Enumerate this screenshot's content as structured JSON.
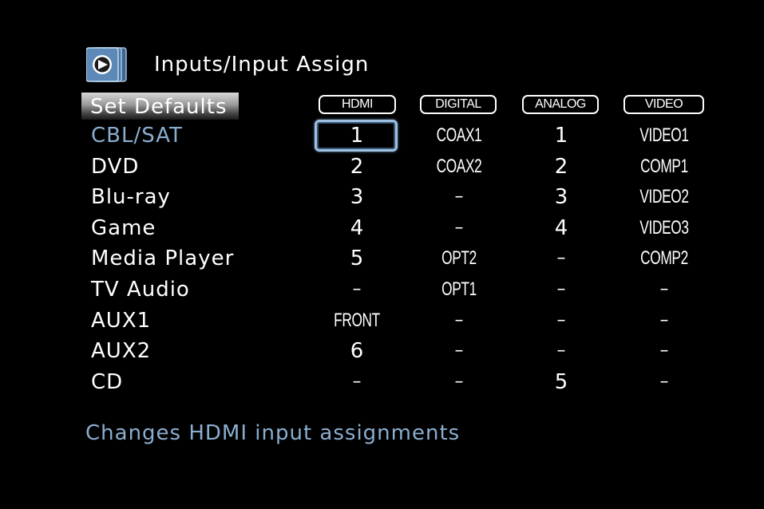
{
  "header": {
    "title": "Inputs/Input Assign",
    "icon": "play-arrow-icon"
  },
  "set_defaults_label": "Set Defaults",
  "columns": [
    "HDMI",
    "DIGITAL",
    "ANALOG",
    "VIDEO"
  ],
  "rows": [
    {
      "label": "CBL/SAT",
      "cells": [
        "1",
        "COAX1",
        "1",
        "VIDEO1"
      ]
    },
    {
      "label": "DVD",
      "cells": [
        "2",
        "COAX2",
        "2",
        "COMP1"
      ]
    },
    {
      "label": "Blu-ray",
      "cells": [
        "3",
        "–",
        "3",
        "VIDEO2"
      ]
    },
    {
      "label": "Game",
      "cells": [
        "4",
        "–",
        "4",
        "VIDEO3"
      ]
    },
    {
      "label": "Media Player",
      "cells": [
        "5",
        "OPT2",
        "–",
        "COMP2"
      ]
    },
    {
      "label": "TV Audio",
      "cells": [
        "–",
        "OPT1",
        "–",
        "–"
      ]
    },
    {
      "label": "AUX1",
      "cells": [
        "FRONT",
        "–",
        "–",
        "–"
      ]
    },
    {
      "label": "AUX2",
      "cells": [
        "6",
        "–",
        "–",
        "–"
      ]
    },
    {
      "label": "CD",
      "cells": [
        "–",
        "–",
        "5",
        "–"
      ]
    }
  ],
  "help_text": "Changes HDMI input assignments",
  "colors": {
    "background": "#000000",
    "text": "#ffffff",
    "accent": "#8aaed0",
    "cursor": "#9fc0e0"
  }
}
